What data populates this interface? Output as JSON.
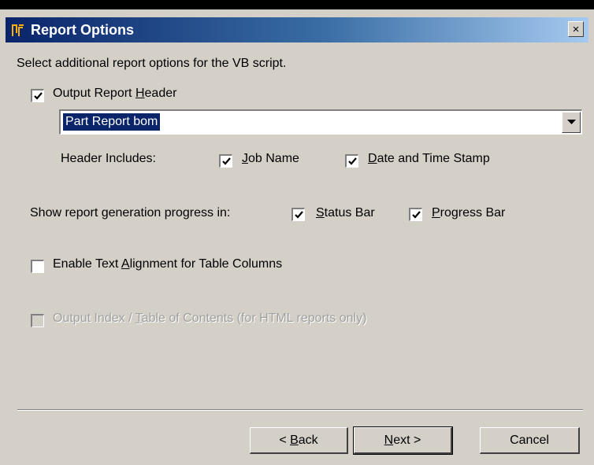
{
  "window": {
    "title": "Report Options",
    "close_label": "×",
    "icon": "app-icon"
  },
  "instruction": "Select additional report options for the VB script.",
  "output_header": {
    "checked": true,
    "label_pre": "Output Report ",
    "label_u": "H",
    "label_post": "eader"
  },
  "header_combo": {
    "value": "Part Report bom"
  },
  "header_includes": {
    "label": "Header Includes:",
    "job_name": {
      "checked": true,
      "u": "J",
      "rest": "ob Name"
    },
    "date_time": {
      "checked": true,
      "u": "D",
      "rest": "ate and Time Stamp"
    }
  },
  "progress": {
    "label": "Show report generation progress in:",
    "status_bar": {
      "checked": true,
      "u": "S",
      "rest": "tatus Bar"
    },
    "progress_bar": {
      "checked": true,
      "u": "P",
      "rest": "rogress Bar"
    }
  },
  "text_alignment": {
    "checked": false,
    "pre": "Enable Text ",
    "u": "A",
    "post": "lignment for Table Columns"
  },
  "output_index": {
    "checked": false,
    "disabled": true,
    "pre": "Output Index / ",
    "u": "T",
    "post": "able of Contents (for HTML reports only)"
  },
  "buttons": {
    "back_pre": "< ",
    "back_u": "B",
    "back_post": "ack",
    "next_u": "N",
    "next_post": "ext >",
    "cancel": "Cancel"
  }
}
